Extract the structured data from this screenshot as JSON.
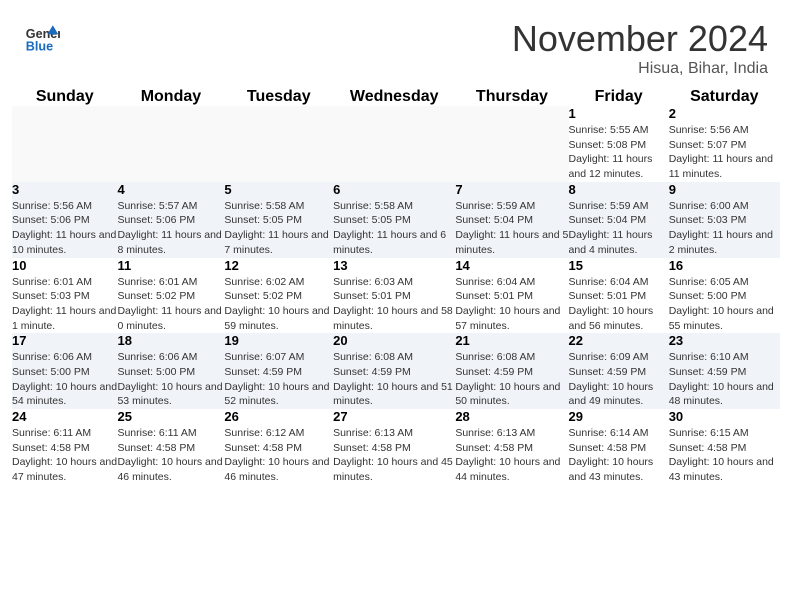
{
  "header": {
    "logo_general": "General",
    "logo_blue": "Blue",
    "month_title": "November 2024",
    "location": "Hisua, Bihar, India"
  },
  "days_of_week": [
    "Sunday",
    "Monday",
    "Tuesday",
    "Wednesday",
    "Thursday",
    "Friday",
    "Saturday"
  ],
  "weeks": [
    [
      {
        "day": "",
        "info": ""
      },
      {
        "day": "",
        "info": ""
      },
      {
        "day": "",
        "info": ""
      },
      {
        "day": "",
        "info": ""
      },
      {
        "day": "",
        "info": ""
      },
      {
        "day": "1",
        "info": "Sunrise: 5:55 AM\nSunset: 5:08 PM\nDaylight: 11 hours and 12 minutes."
      },
      {
        "day": "2",
        "info": "Sunrise: 5:56 AM\nSunset: 5:07 PM\nDaylight: 11 hours and 11 minutes."
      }
    ],
    [
      {
        "day": "3",
        "info": "Sunrise: 5:56 AM\nSunset: 5:06 PM\nDaylight: 11 hours and 10 minutes."
      },
      {
        "day": "4",
        "info": "Sunrise: 5:57 AM\nSunset: 5:06 PM\nDaylight: 11 hours and 8 minutes."
      },
      {
        "day": "5",
        "info": "Sunrise: 5:58 AM\nSunset: 5:05 PM\nDaylight: 11 hours and 7 minutes."
      },
      {
        "day": "6",
        "info": "Sunrise: 5:58 AM\nSunset: 5:05 PM\nDaylight: 11 hours and 6 minutes."
      },
      {
        "day": "7",
        "info": "Sunrise: 5:59 AM\nSunset: 5:04 PM\nDaylight: 11 hours and 5 minutes."
      },
      {
        "day": "8",
        "info": "Sunrise: 5:59 AM\nSunset: 5:04 PM\nDaylight: 11 hours and 4 minutes."
      },
      {
        "day": "9",
        "info": "Sunrise: 6:00 AM\nSunset: 5:03 PM\nDaylight: 11 hours and 2 minutes."
      }
    ],
    [
      {
        "day": "10",
        "info": "Sunrise: 6:01 AM\nSunset: 5:03 PM\nDaylight: 11 hours and 1 minute."
      },
      {
        "day": "11",
        "info": "Sunrise: 6:01 AM\nSunset: 5:02 PM\nDaylight: 11 hours and 0 minutes."
      },
      {
        "day": "12",
        "info": "Sunrise: 6:02 AM\nSunset: 5:02 PM\nDaylight: 10 hours and 59 minutes."
      },
      {
        "day": "13",
        "info": "Sunrise: 6:03 AM\nSunset: 5:01 PM\nDaylight: 10 hours and 58 minutes."
      },
      {
        "day": "14",
        "info": "Sunrise: 6:04 AM\nSunset: 5:01 PM\nDaylight: 10 hours and 57 minutes."
      },
      {
        "day": "15",
        "info": "Sunrise: 6:04 AM\nSunset: 5:01 PM\nDaylight: 10 hours and 56 minutes."
      },
      {
        "day": "16",
        "info": "Sunrise: 6:05 AM\nSunset: 5:00 PM\nDaylight: 10 hours and 55 minutes."
      }
    ],
    [
      {
        "day": "17",
        "info": "Sunrise: 6:06 AM\nSunset: 5:00 PM\nDaylight: 10 hours and 54 minutes."
      },
      {
        "day": "18",
        "info": "Sunrise: 6:06 AM\nSunset: 5:00 PM\nDaylight: 10 hours and 53 minutes."
      },
      {
        "day": "19",
        "info": "Sunrise: 6:07 AM\nSunset: 4:59 PM\nDaylight: 10 hours and 52 minutes."
      },
      {
        "day": "20",
        "info": "Sunrise: 6:08 AM\nSunset: 4:59 PM\nDaylight: 10 hours and 51 minutes."
      },
      {
        "day": "21",
        "info": "Sunrise: 6:08 AM\nSunset: 4:59 PM\nDaylight: 10 hours and 50 minutes."
      },
      {
        "day": "22",
        "info": "Sunrise: 6:09 AM\nSunset: 4:59 PM\nDaylight: 10 hours and 49 minutes."
      },
      {
        "day": "23",
        "info": "Sunrise: 6:10 AM\nSunset: 4:59 PM\nDaylight: 10 hours and 48 minutes."
      }
    ],
    [
      {
        "day": "24",
        "info": "Sunrise: 6:11 AM\nSunset: 4:58 PM\nDaylight: 10 hours and 47 minutes."
      },
      {
        "day": "25",
        "info": "Sunrise: 6:11 AM\nSunset: 4:58 PM\nDaylight: 10 hours and 46 minutes."
      },
      {
        "day": "26",
        "info": "Sunrise: 6:12 AM\nSunset: 4:58 PM\nDaylight: 10 hours and 46 minutes."
      },
      {
        "day": "27",
        "info": "Sunrise: 6:13 AM\nSunset: 4:58 PM\nDaylight: 10 hours and 45 minutes."
      },
      {
        "day": "28",
        "info": "Sunrise: 6:13 AM\nSunset: 4:58 PM\nDaylight: 10 hours and 44 minutes."
      },
      {
        "day": "29",
        "info": "Sunrise: 6:14 AM\nSunset: 4:58 PM\nDaylight: 10 hours and 43 minutes."
      },
      {
        "day": "30",
        "info": "Sunrise: 6:15 AM\nSunset: 4:58 PM\nDaylight: 10 hours and 43 minutes."
      }
    ]
  ]
}
